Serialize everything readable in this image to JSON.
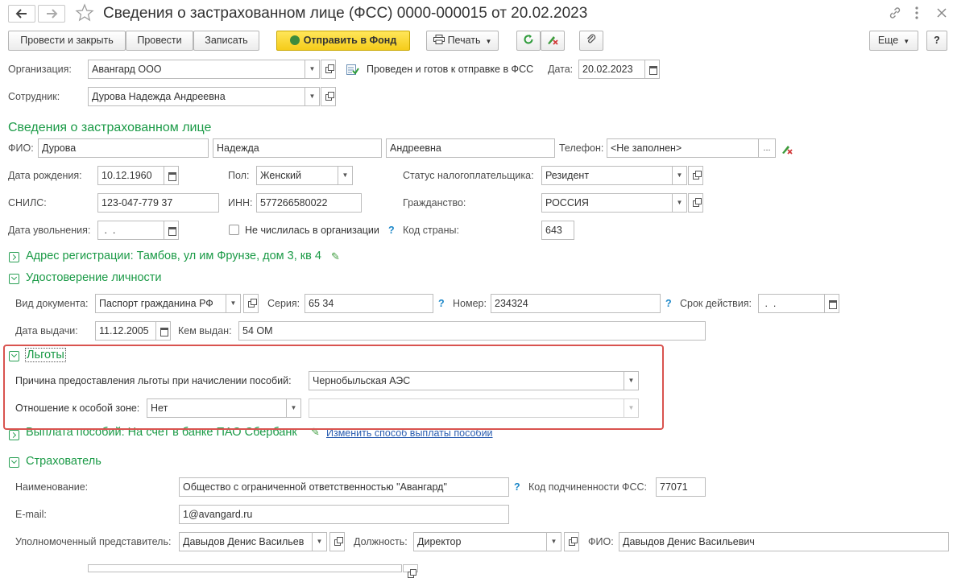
{
  "window": {
    "title": "Сведения о застрахованном лице (ФСС) 0000-000015 от 20.02.2023",
    "icons": [
      "back-arrow-icon",
      "forward-arrow-icon",
      "star-icon",
      "link-icon",
      "more-icon",
      "close-icon"
    ]
  },
  "toolbar": {
    "post_close": "Провести и закрыть",
    "post": "Провести",
    "save": "Записать",
    "send": "Отправить в Фонд",
    "print": "Печать",
    "more": "Еще",
    "help": "?"
  },
  "header": {
    "org_label": "Организация:",
    "org_value": "Авангард ООО",
    "status_text": "Проведен и готов к отправке в ФСС",
    "date_label": "Дата:",
    "date_value": "20.02.2023",
    "employee_label": "Сотрудник:",
    "employee_value": "Дурова Надежда Андреевна"
  },
  "insured": {
    "section_title": "Сведения о застрахованном лице",
    "fio_label": "ФИО:",
    "last_name": "Дурова",
    "first_name": "Надежда",
    "middle_name": "Андреевна",
    "phone_label": "Телефон:",
    "phone_value": "<Не заполнен>",
    "birth_label": "Дата рождения:",
    "birth_value": "10.12.1960",
    "sex_label": "Пол:",
    "sex_value": "Женский",
    "tax_status_label": "Статус налогоплательщика:",
    "tax_status_value": "Резидент",
    "snils_label": "СНИЛС:",
    "snils_value": "123-047-779 37",
    "inn_label": "ИНН:",
    "inn_value": "577266580022",
    "citizenship_label": "Гражданство:",
    "citizenship_value": "РОССИЯ",
    "dismissal_label": "Дата увольнения:",
    "dismissal_value": " .  .",
    "not_listed_label": "Не числилась в организации",
    "country_code_label": "Код страны:",
    "country_code_value": "643"
  },
  "address": {
    "title": "Адрес регистрации: Тамбов, ул им Фрунзе, дом 3, кв 4"
  },
  "identity": {
    "title": "Удостоверение личности",
    "doc_type_label": "Вид документа:",
    "doc_type_value": "Паспорт гражданина РФ",
    "series_label": "Серия:",
    "series_value": "65 34",
    "number_label": "Номер:",
    "number_value": "234324",
    "valid_label": "Срок действия:",
    "valid_value": " .  .",
    "issue_date_label": "Дата выдачи:",
    "issue_date_value": "11.12.2005",
    "issued_by_label": "Кем выдан:",
    "issued_by_value": "54 ОМ"
  },
  "benefits": {
    "title": "Льготы",
    "reason_label": "Причина предоставления льготы при начислении пособий:",
    "reason_value": "Чернобыльская АЭС",
    "zone_label": "Отношение к особой зоне:",
    "zone_value": "Нет",
    "zone_extra_value": ""
  },
  "payment": {
    "title": "Выплата пособий: На счет в банке ПАО Сбербанк",
    "change_link": "Изменить способ выплаты пособий"
  },
  "insurer": {
    "title": "Страхователь",
    "name_label": "Наименование:",
    "name_value": "Общество с ограниченной ответственностью \"Авангард\"",
    "code_label": "Код подчиненности ФСС:",
    "code_value": "77071",
    "email_label": "E-mail:",
    "email_value": "1@avangard.ru",
    "rep_label": "Уполномоченный представитель:",
    "rep_value": "Давыдов Денис Васильев",
    "position_label": "Должность:",
    "position_value": "Директор",
    "rep_fio_label": "ФИО:",
    "rep_fio_value": "Давыдов Денис Васильевич"
  },
  "help_mark": "?"
}
